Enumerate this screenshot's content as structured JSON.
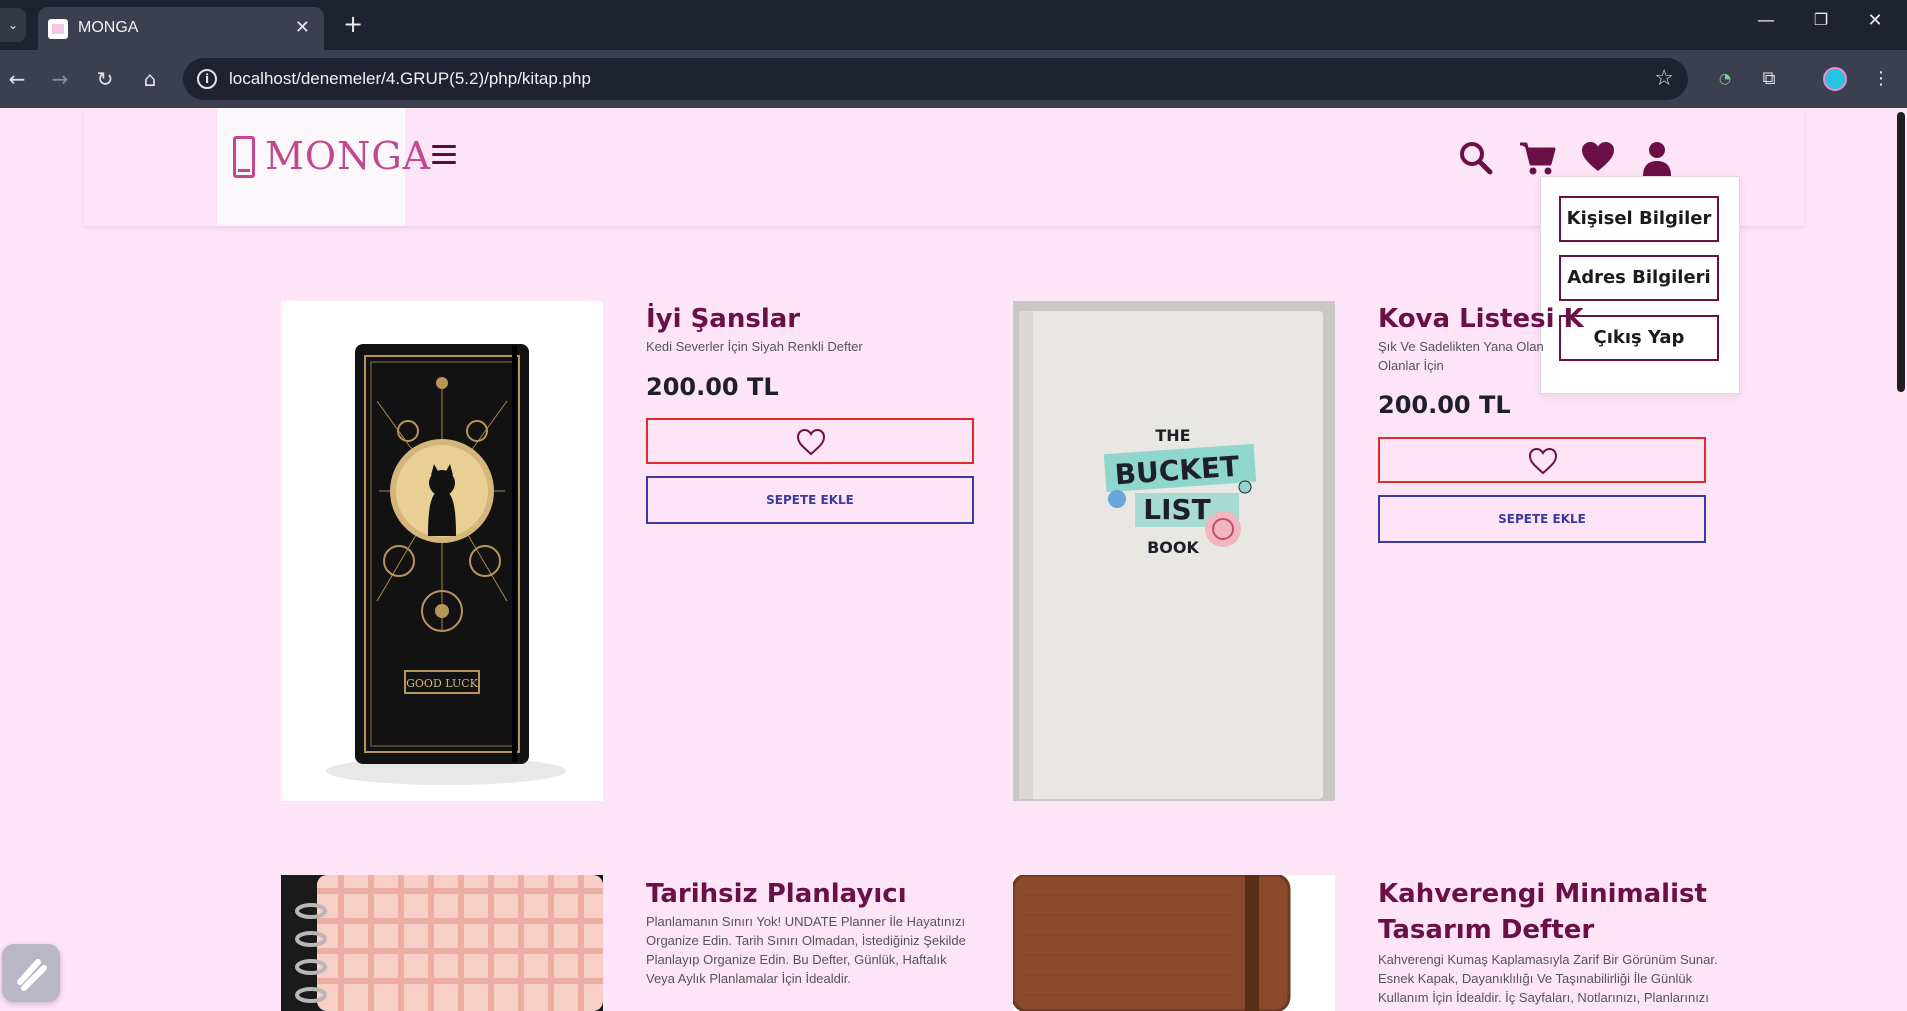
{
  "browser": {
    "tab_title": "MONGA",
    "tab_close": "✕",
    "new_tab": "+",
    "url": "localhost/denemeler/4.GRUP(5.2)/php/kitap.php",
    "window_controls": [
      "—",
      "❐",
      "✕"
    ]
  },
  "header": {
    "logo_text": "MONGA",
    "icons": [
      "search-icon",
      "cart-icon",
      "heart-icon",
      "user-icon"
    ],
    "color_primary": "#6b0f47"
  },
  "user_menu": {
    "items": [
      "Kişisel Bilgiler",
      "Adres Bilgileri",
      "Çıkış Yap"
    ]
  },
  "products": [
    {
      "title": "İyi Şanslar",
      "description": "Kedi Severler İçin Siyah Renkli Defter",
      "price": "200.00 TL",
      "cart_label": "SEPETE EKLE"
    },
    {
      "title": "Kova Listesi K",
      "description": "Şık Ve Sadelikten Yana Olan Olanlar İçin",
      "price": "200.00 TL",
      "cart_label": "SEPETE EKLE",
      "image_text": [
        "THE",
        "BUCKET",
        "LIST",
        "BOOK"
      ]
    },
    {
      "title": "Tarihsiz Planlayıcı",
      "description": "Planlamanın Sınırı Yok! UNDATE Planner İle Hayatınızı Organize Edin. Tarih Sınırı Olmadan, İstediğiniz Şekilde Planlayıp Organize Edin. Bu Defter, Günlük, Haftalık Veya Aylık Planlamalar İçin İdealdir."
    },
    {
      "title": "Kahverengi Minimalist Tasarım Defter",
      "description": "Kahverengi Kumaş Kaplamasıyla Zarif Bir Görünüm Sunar. Esnek Kapak, Dayanıklılığı Ve Taşınabilirliği İle Günlük Kullanım İçin İdealdir. İç Sayfaları, Notlarınızı, Planlarınızı"
    }
  ]
}
